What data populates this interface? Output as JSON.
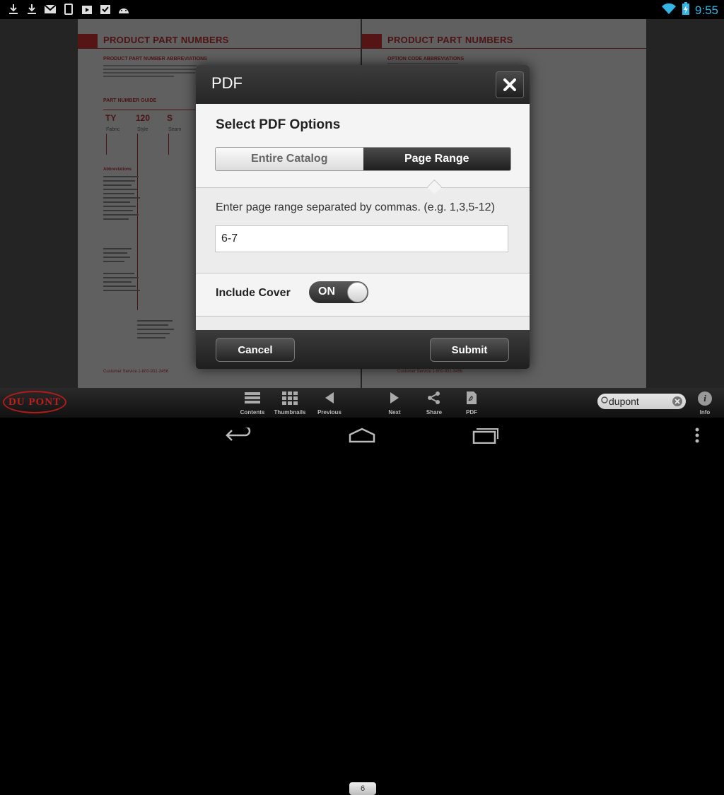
{
  "status_bar": {
    "time": "9:55",
    "left_icons": [
      "download-icon",
      "download-icon",
      "gmail-icon",
      "phone-icon",
      "play-store-icon",
      "tasks-icon",
      "android-icon"
    ]
  },
  "document": {
    "left_page": {
      "heading": "PRODUCT PART NUMBERS",
      "subheading": "PRODUCT PART NUMBER ABBREVIATIONS",
      "guide_heading": "PART NUMBER GUIDE",
      "codes": [
        "TY",
        "120",
        "S"
      ],
      "code_labels": [
        "Fabric",
        "Style",
        "Seam"
      ],
      "abbrev_heading": "Abbreviations",
      "footer": "Customer Service 1-800-931-3456"
    },
    "right_page": {
      "heading": "PRODUCT PART NUMBERS",
      "subheading": "OPTION CODE ABBREVIATIONS",
      "footer": "Customer Service 1-800-931-3456"
    }
  },
  "dialog": {
    "title": "PDF",
    "section_title": "Select PDF Options",
    "tabs": [
      {
        "label": "Entire Catalog",
        "active": false
      },
      {
        "label": "Page Range",
        "active": true
      }
    ],
    "range_label": "Enter page range separated by commas. (e.g. 1,3,5-12)",
    "range_value": "6-7",
    "include_cover_label": "Include Cover",
    "include_cover_state": "ON",
    "cancel_label": "Cancel",
    "submit_label": "Submit"
  },
  "toolbar": {
    "logo_text": "DU PONT",
    "contents_label": "Contents",
    "thumbnails_label": "Thumbnails",
    "previous_label": "Previous",
    "page_number": "6",
    "next_label": "Next",
    "share_label": "Share",
    "pdf_label": "PDF",
    "search_value": "dupont",
    "info_label": "Info"
  },
  "colors": {
    "accent": "#33b5e5",
    "brand_red": "#c21d1d"
  }
}
